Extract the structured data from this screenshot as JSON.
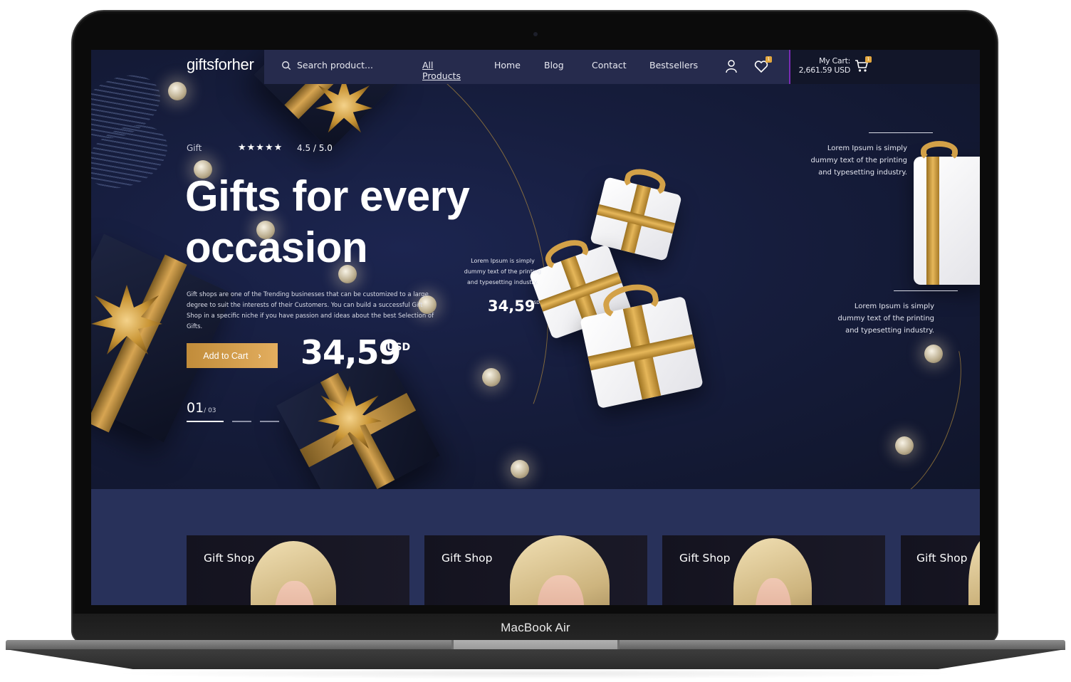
{
  "device": {
    "label": "MacBook Air"
  },
  "header": {
    "logo": "giftsforher",
    "search_placeholder": "Search product...",
    "nav": [
      {
        "label": "All Products",
        "active": true
      },
      {
        "label": "Home"
      },
      {
        "label": "Blog"
      },
      {
        "label": "Contact"
      },
      {
        "label": "Bestsellers"
      }
    ],
    "wishlist_count": "1",
    "cart": {
      "label": "My Cart:",
      "total": "2,661.59 USD",
      "count": "1"
    },
    "colors": {
      "nav_bg": "#262b4d",
      "cart_bg": "#121629",
      "cart_divider": "#7a2bb5",
      "badge": "#e3a73f"
    }
  },
  "hero": {
    "eyebrow": "Gift",
    "stars": "★★★★★",
    "rating": "4.5",
    "rating_max": "/ 5.0",
    "title": "Gifts for every occasion",
    "description": "Gift shops are one of the Trending businesses that can be customized to a large degree to suit the interests of their Customers. You can build a successful Gift Shop in a specific niche if you have passion and ideas about the best Selection of Gifts.",
    "cta_label": "Add to Cart",
    "cta_arrow": "›",
    "price": "34,59",
    "currency": "USD",
    "slide_current": "01",
    "slide_total": "/ 03",
    "colors": {
      "accent": "#d9a450",
      "bg": "#161d3d"
    }
  },
  "callouts": [
    {
      "text": "Lorem Ipsum is simply dummy text of the printing and typesetting industry."
    },
    {
      "text": "Lorem Ipsum is simply dummy text of the printing and typesetting industry."
    },
    {
      "text": "Lorem Ipsum is simply dummy text of the printing and typesetting industry."
    }
  ],
  "secondary_price": {
    "price": "34,59",
    "currency": "USD"
  },
  "cards": [
    {
      "title": "Gift Shop"
    },
    {
      "title": "Gift Shop"
    },
    {
      "title": "Gift Shop"
    },
    {
      "title": "Gift Shop"
    }
  ]
}
